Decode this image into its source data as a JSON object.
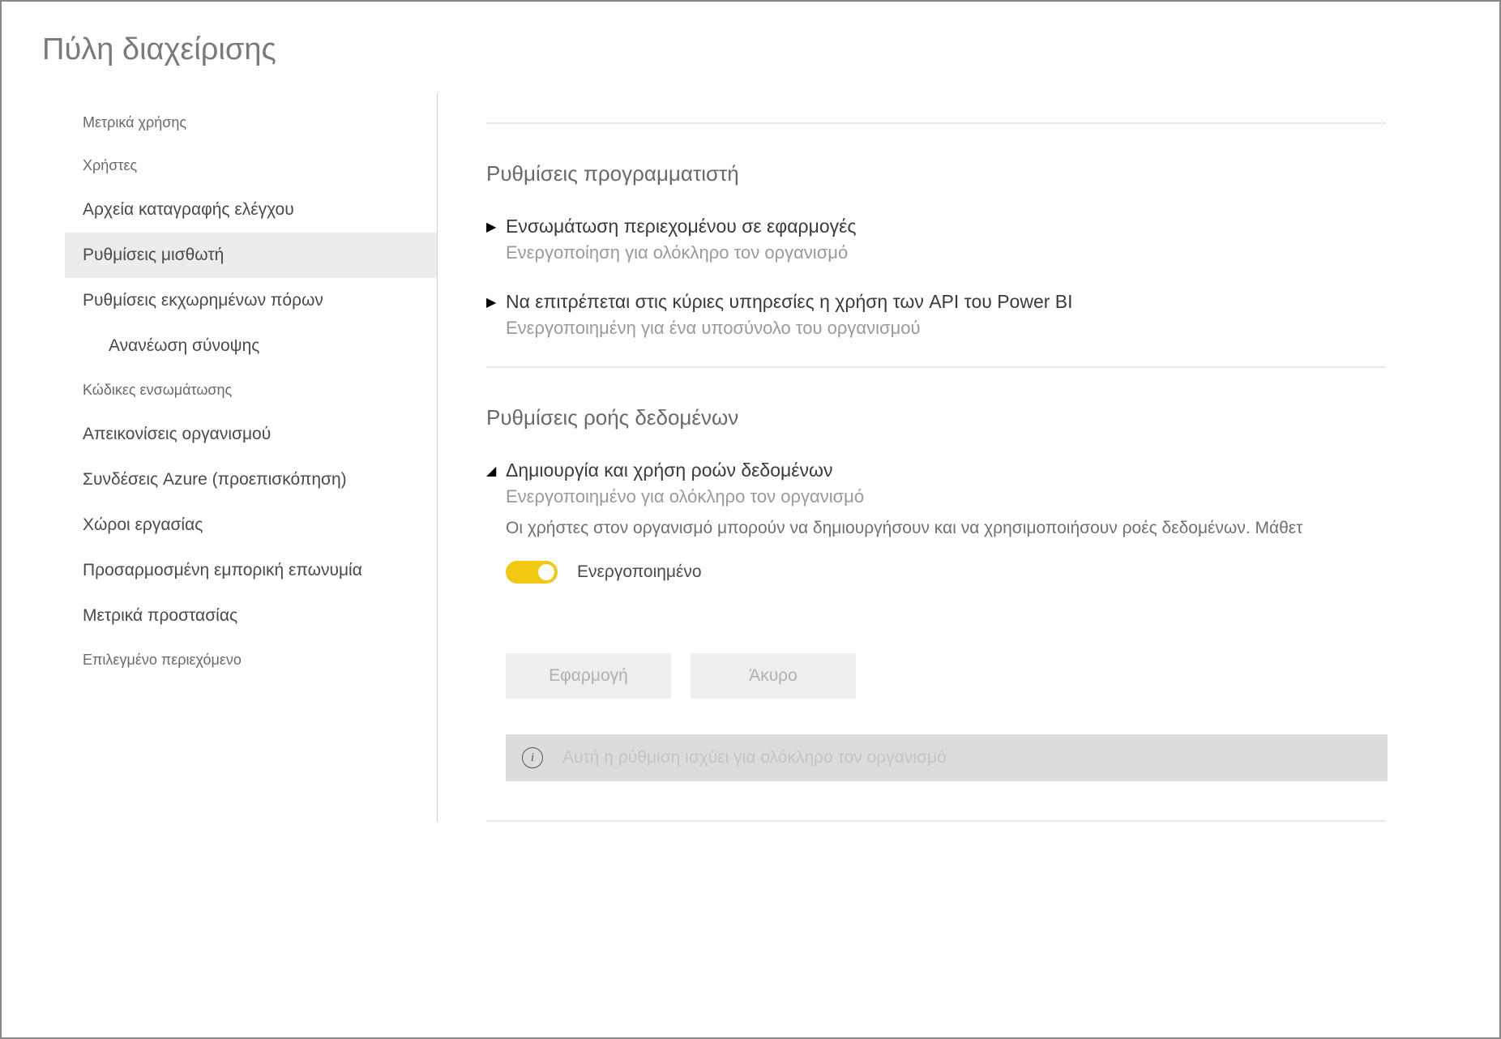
{
  "header": {
    "title": "Πύλη διαχείρισης"
  },
  "sidebar": {
    "items": [
      {
        "label": "Μετρικά χρήσης",
        "active": false,
        "small": true
      },
      {
        "label": "Χρήστες",
        "active": false,
        "small": true
      },
      {
        "label": "Αρχεία καταγραφής ελέγχου",
        "active": false
      },
      {
        "label": "Ρυθμίσεις μισθωτή",
        "active": true
      },
      {
        "label": "Ρυθμίσεις εκχωρημένων πόρων",
        "active": false
      },
      {
        "label": "Ανανέωση σύνοψης",
        "active": false,
        "sub": true
      },
      {
        "label": "Κώδικες ενσωμάτωσης",
        "active": false,
        "small": true
      },
      {
        "label": "Απεικονίσεις οργανισμού",
        "active": false
      },
      {
        "label": "Συνδέσεις Azure (προεπισκόπηση)",
        "active": false
      },
      {
        "label": "Χώροι εργασίας",
        "active": false
      },
      {
        "label": "Προσαρμοσμένη εμπορική επωνυμία",
        "active": false
      },
      {
        "label": "Μετρικά προστασίας",
        "active": false
      },
      {
        "label": "Επιλεγμένο περιεχόμενο",
        "active": false,
        "small": true
      }
    ]
  },
  "main": {
    "section1": {
      "title": "Ρυθμίσεις προγραμματιστή",
      "settings": [
        {
          "title": "Ενσωμάτωση περιεχομένου σε εφαρμογές",
          "subtitle": "Ενεργοποίηση για ολόκληρο τον οργανισμό"
        },
        {
          "title": "Να επιτρέπεται στις κύριες υπηρεσίες η χρήση των API του Power BI",
          "subtitle": "Ενεργοποιημένη για ένα υποσύνολο του οργανισμού"
        }
      ]
    },
    "section2": {
      "title": "Ρυθμίσεις ροής δεδομένων",
      "setting": {
        "title": "Δημιουργία και χρήση ροών δεδομένων",
        "subtitle": "Ενεργοποιημένο για ολόκληρο τον οργανισμό",
        "description": "Οι χρήστες στον οργανισμό μπορούν να δημιουργήσουν και να χρησιμοποιήσουν ροές δεδομένων. Μάθετ",
        "toggle_label": "Ενεργοποιημένο"
      },
      "buttons": {
        "apply": "Εφαρμογή",
        "cancel": "Άκυρο"
      },
      "info": "Αυτή η ρύθμιση ισχύει για ολόκληρο τον οργανισμό"
    }
  }
}
